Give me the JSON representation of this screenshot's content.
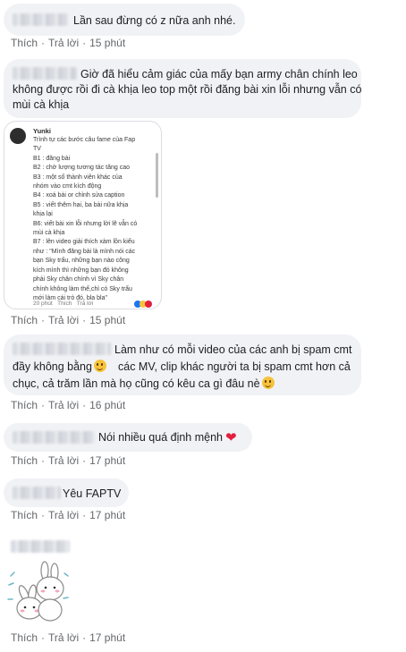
{
  "actions": {
    "like": "Thích",
    "reply": "Trả lời",
    "sep": "·"
  },
  "comments": [
    {
      "text": "Lần sau đừng có z nữa anh nhé.",
      "time": "15 phút"
    },
    {
      "lines": [
        "Giờ đã hiểu cảm giác của mấy bạn army chân chính leo",
        "không được rồi đi cà khịa leo top một rồi đăng bài xin lỗi nhưng vẫn có",
        "mùi cà khịa"
      ],
      "time": "15 phút"
    },
    {
      "lines": [
        "Làm như có mỗi video của các anh bị spam cmt",
        "đầy không bằng",
        "các MV, clip khác người ta bị spam cmt hơn cả",
        "chục, cả trăm lần mà họ cũng có kêu ca gì đâu nè"
      ],
      "time": "16 phút"
    },
    {
      "text": "Nói nhiều quá định mệnh",
      "time": "17 phút"
    },
    {
      "text": "Yêu FAPTV",
      "time": "17 phút"
    },
    {
      "time": "17 phút"
    }
  ],
  "screenshot": {
    "author": "Yunki",
    "lines": [
      "Trình tự các bước câu fame của Fap",
      "TV",
      "B1 : đăng bài",
      "B2 : chờ lượng tương tác tăng cao",
      "B3 : một số thành viên khác của",
      "nhóm vào cmt kích động",
      "B4 : xoá bài or chỉnh sửa caption",
      "B5 : viết thêm hai, ba bài nữa khịa",
      "khịa lại",
      "B6: viết bài xin lỗi nhưng lời lẽ vẫn có",
      "mùi cà khịa",
      "B7 : lên video giải thích xàm lồn kiểu",
      "như : \"Mình đăng bài là mình nói các",
      "bạn Sky trẩu, những bạn nào công",
      "kích mình thì những bạn đó không",
      "phải Sky chân chính vì Sky chân",
      "chính không làm thế,chỉ có Sky trẩu",
      "mới làm cái trò đó, bla bla\""
    ],
    "meta_time": "20 phút",
    "meta_like": "Thích",
    "meta_reply": "Trả lời"
  },
  "colors": {
    "bubble": "#f0f2f5",
    "meta": "#65676b",
    "heart": "#e41e3f"
  }
}
